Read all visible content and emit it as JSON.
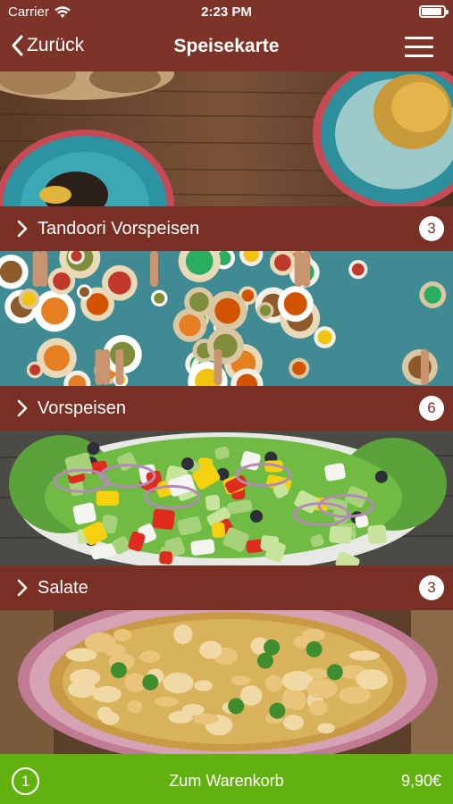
{
  "status_bar": {
    "carrier": "Carrier",
    "time": "2:23 PM"
  },
  "nav": {
    "back_label": "Zurück",
    "title": "Speisekarte"
  },
  "categories": [
    {
      "label": "Tandoori Vorspeisen",
      "count": "3",
      "image": "tandoori-food-photo"
    },
    {
      "label": "Vorspeisen",
      "count": "6",
      "image": "shared-table-food-photo"
    },
    {
      "label": "Salate",
      "count": "3",
      "image": "salad-photo"
    },
    {
      "label": "",
      "count": "",
      "image": "soup-photo"
    }
  ],
  "cart": {
    "quantity": "1",
    "label": "Zum Warenkorb",
    "total": "9,90€"
  },
  "colors": {
    "nav": "#7d3328",
    "bar": "#7a2f25",
    "cart": "#62b20f"
  }
}
